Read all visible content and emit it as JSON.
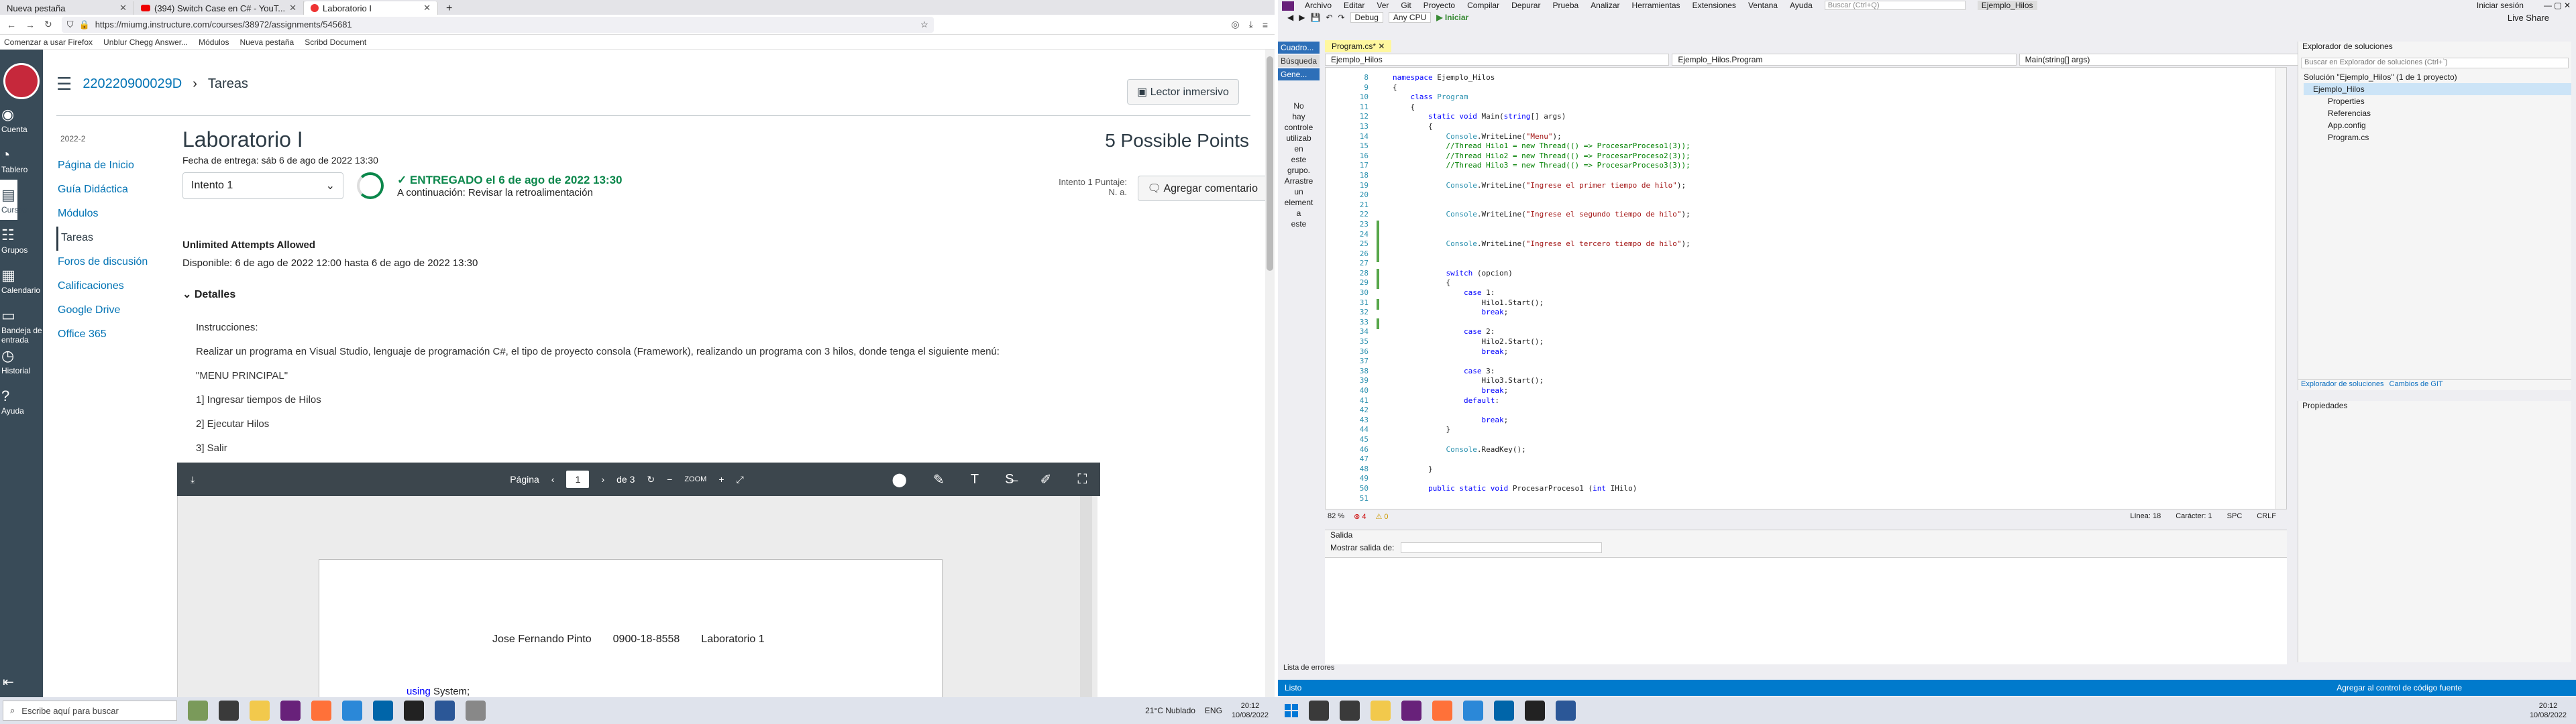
{
  "firefox": {
    "tabs": [
      {
        "label": "Nueva pestaña"
      },
      {
        "label": "(394) Switch Case en C# - YouT..."
      },
      {
        "label": "Laboratorio I"
      }
    ],
    "new_tab_glyph": "+",
    "url": "https://miumg.instructure.com/courses/38972/assignments/545681",
    "bookmarks": [
      "Comenzar a usar Firefox",
      "Unblur Chegg Answer...",
      "Módulos",
      "Nueva pestaña",
      "Scribd Document"
    ]
  },
  "canvas": {
    "rail": [
      "Cuenta",
      "Tablero",
      "Cursos",
      "Grupos",
      "Calendario",
      "Bandeja de entrada",
      "Historial",
      "Ayuda"
    ],
    "breadcrumb": {
      "course": "220220900029D",
      "sep": "›",
      "page": "Tareas"
    },
    "immersive": "Lector inmersivo",
    "term": "2022-2",
    "course_nav": [
      "Página de Inicio",
      "Guía Didáctica",
      "Módulos",
      "Tareas",
      "Foros de discusión",
      "Calificaciones",
      "Google Drive",
      "Office 365"
    ],
    "title": "Laboratorio I",
    "points": "5 Possible Points",
    "due": "Fecha de entrega: sáb 6 de ago de 2022 13:30",
    "attempt_select": "Intento 1",
    "submitted": "ENTREGADO el 6 de ago de 2022 13:30",
    "next": "A continuación: Revisar la retroalimentación",
    "score_label": "Intento 1 Puntaje:",
    "score_value": "N. a.",
    "add_comment": "Agregar comentario",
    "unlimited": "Unlimited Attempts Allowed",
    "available": "Disponible: 6 de ago de 2022 12:00 hasta 6 de ago de 2022 13:30",
    "details_h": "Detalles",
    "details": [
      "Instrucciones:",
      "Realizar un programa en Visual Studio, lenguaje de programación C#, el tipo de proyecto consola (Framework), realizando un programa con 3 hilos, donde tenga el siguiente menú:",
      "\"MENU PRINCIPAL\"",
      "1] Ingresar tiempos de Hilos",
      "2] Ejecutar Hilos",
      "3] Salir"
    ],
    "pdf": {
      "page_label": "Página",
      "page": "1",
      "of": "de 3",
      "zoom": "ZOOM"
    },
    "pdf_line": [
      "Jose Fernando Pinto",
      "0900-18-8558",
      "Laboratorio 1"
    ],
    "pdf_using_kw": "using",
    "pdf_using_rest": " System;"
  },
  "vs": {
    "menu": [
      "Archivo",
      "Editar",
      "Ver",
      "Git",
      "Proyecto",
      "Compilar",
      "Depurar",
      "Prueba",
      "Analizar",
      "Herramientas",
      "Extensiones",
      "Ventana",
      "Ayuda"
    ],
    "search": "Buscar (Ctrl+Q)",
    "project_title": "Ejemplo_Hilos",
    "signin": "Iniciar sesión",
    "toolbar": {
      "config": "Debug",
      "platform": "Any CPU",
      "run": "▶ Iniciar"
    },
    "liveshare": "Live Share",
    "left_tabs": [
      "Cuadro...",
      "Búsqueda",
      "Gene..."
    ],
    "left_msg": [
      "No",
      "hay",
      "controle",
      "utilizab",
      "en",
      "este",
      "grupo.",
      "Arrastre",
      "un",
      "element",
      "a",
      "este"
    ],
    "doc_tab": "Program.cs*",
    "navbar": [
      "Ejemplo_Hilos",
      "Ejemplo_Hilos.Program",
      "Main(string[] args)"
    ],
    "line_numbers": [
      "8",
      "9",
      "10",
      "11",
      "12",
      "13",
      "14",
      "15",
      "16",
      "17",
      "18",
      "19",
      "20",
      "21",
      "22",
      "23",
      "24",
      "25",
      "26",
      "27",
      "28",
      "29",
      "30",
      "31",
      "32",
      "33",
      "34",
      "35",
      "36",
      "37",
      "38",
      "39",
      "40",
      "41",
      "42",
      "43",
      "44",
      "45",
      "46",
      "47",
      "48",
      "49",
      "50",
      "51"
    ],
    "status": {
      "zoom": "82 %",
      "errors": "4",
      "warnings": "0",
      "line": "Línea: 18",
      "col": "Carácter: 1",
      "spc": "SPC",
      "crlf": "CRLF"
    },
    "output_title": "Salida",
    "output_from": "Mostrar salida de:",
    "error_list": "Lista de errores",
    "ready": "Listo",
    "add_source": "Agregar al control de código fuente",
    "sol_title": "Explorador de soluciones",
    "sol_search": "Buscar en Explorador de soluciones (Ctrl+`)",
    "tree": [
      "Solución \"Ejemplo_Hilos\" (1 de 1 proyecto)",
      "Ejemplo_Hilos",
      "Properties",
      "Referencias",
      "App.config",
      "Program.cs"
    ],
    "sol_tabs": [
      "Explorador de soluciones",
      "Cambios de GIT"
    ],
    "props_title": "Propiedades"
  },
  "taskbar": {
    "search": "Escribe aquí para buscar",
    "weather": "21°C  Nublado",
    "lang": "ENG",
    "time": "20:12",
    "date": "10/08/2022"
  }
}
